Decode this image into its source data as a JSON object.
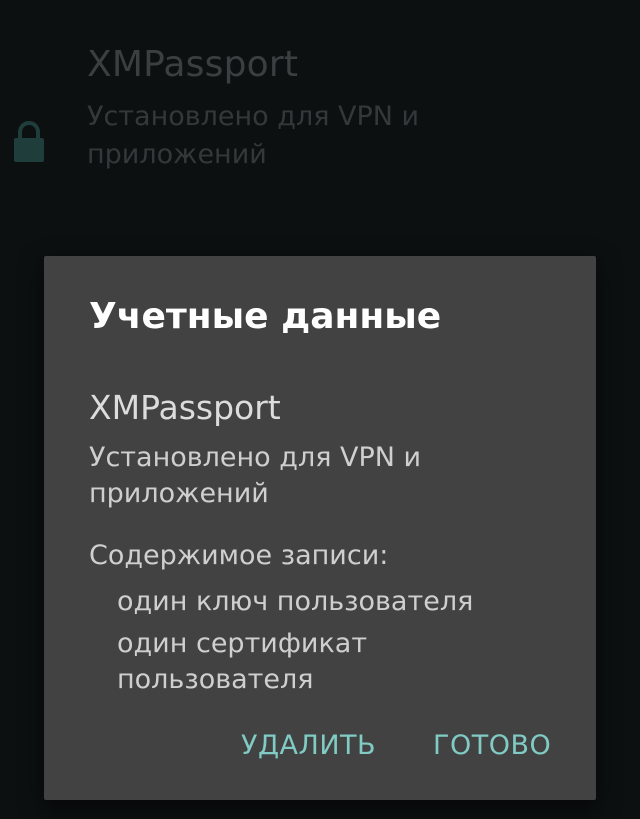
{
  "background": {
    "item_title": "XMPassport",
    "item_subtitle": "Установлено для VPN и приложений",
    "icon": "lock-icon"
  },
  "dialog": {
    "title": "Учетные данные",
    "credential_name": "XMPassport",
    "installed_for": "Установлено для VPN и приложений",
    "contents_label": "Содержимое записи:",
    "contents": [
      "один ключ пользователя",
      "один сертификат пользователя"
    ],
    "delete_label": "УДАЛИТЬ",
    "done_label": "ГОТОВО"
  },
  "colors": {
    "accent": "#80cbc4",
    "dialog_bg": "#424242",
    "lock_icon": "#1f3d3a"
  }
}
